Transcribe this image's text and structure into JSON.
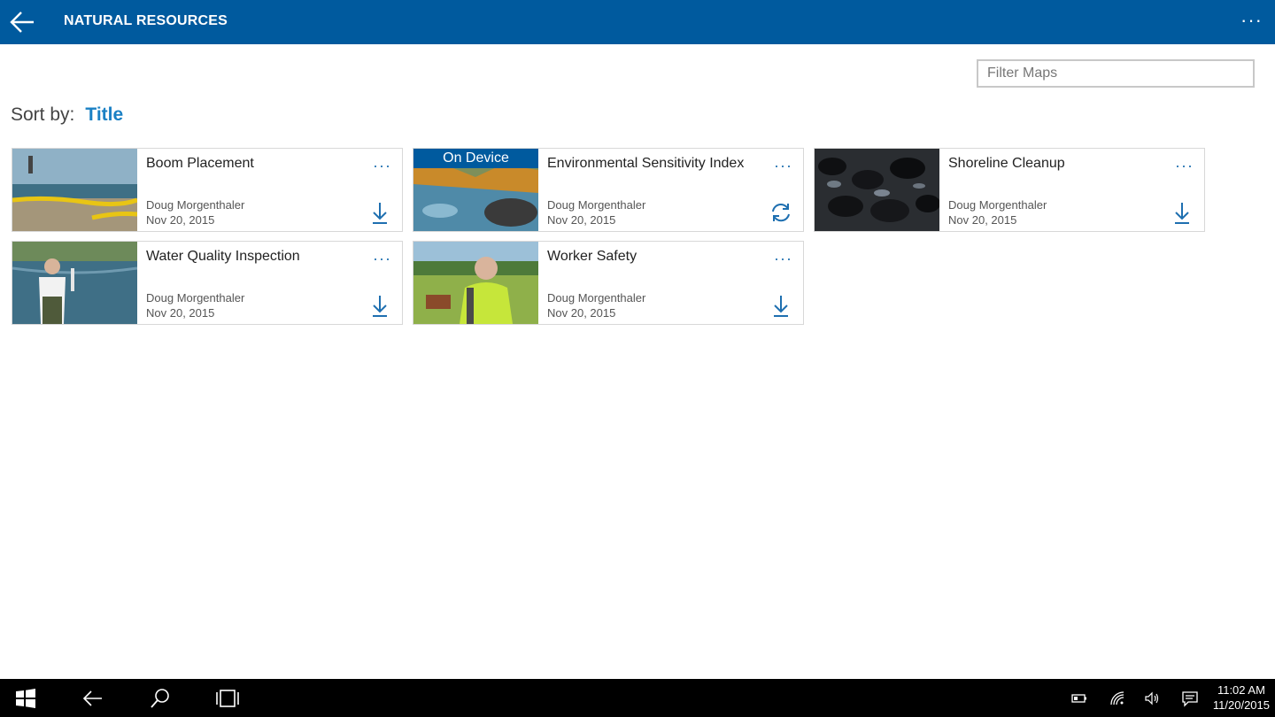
{
  "header": {
    "title": "NATURAL RESOURCES",
    "back_icon": "back-arrow-icon",
    "more_label": "···"
  },
  "filter": {
    "placeholder": "Filter Maps",
    "value": ""
  },
  "sort": {
    "label": "Sort by:",
    "value": "Title"
  },
  "colors": {
    "header": "#005a9e",
    "accent": "#1a80c4",
    "icon": "#1e6fb0"
  },
  "maps": [
    {
      "title": "Boom Placement",
      "owner": "Doug Morgenthaler",
      "date": "Nov 20, 2015",
      "more": "···",
      "action_icon": "download-icon",
      "badge": ""
    },
    {
      "title": "Environmental Sensitivity Index",
      "owner": "Doug Morgenthaler",
      "date": "Nov 20, 2015",
      "more": "···",
      "action_icon": "sync-icon",
      "badge": "On Device"
    },
    {
      "title": "Shoreline Cleanup",
      "owner": "Doug Morgenthaler",
      "date": "Nov 20, 2015",
      "more": "···",
      "action_icon": "download-icon",
      "badge": ""
    },
    {
      "title": "Water Quality Inspection",
      "owner": "Doug Morgenthaler",
      "date": "Nov 20, 2015",
      "more": "···",
      "action_icon": "download-icon",
      "badge": ""
    },
    {
      "title": "Worker Safety",
      "owner": "Doug Morgenthaler",
      "date": "Nov 20, 2015",
      "more": "···",
      "action_icon": "download-icon",
      "badge": ""
    }
  ],
  "taskbar": {
    "icons": [
      "windows-start-icon",
      "back-icon",
      "search-icon",
      "task-view-icon"
    ],
    "tray_icons": [
      "battery-icon",
      "wifi-icon",
      "volume-icon",
      "action-center-icon"
    ],
    "time": "11:02 AM",
    "date": "11/20/2015"
  }
}
